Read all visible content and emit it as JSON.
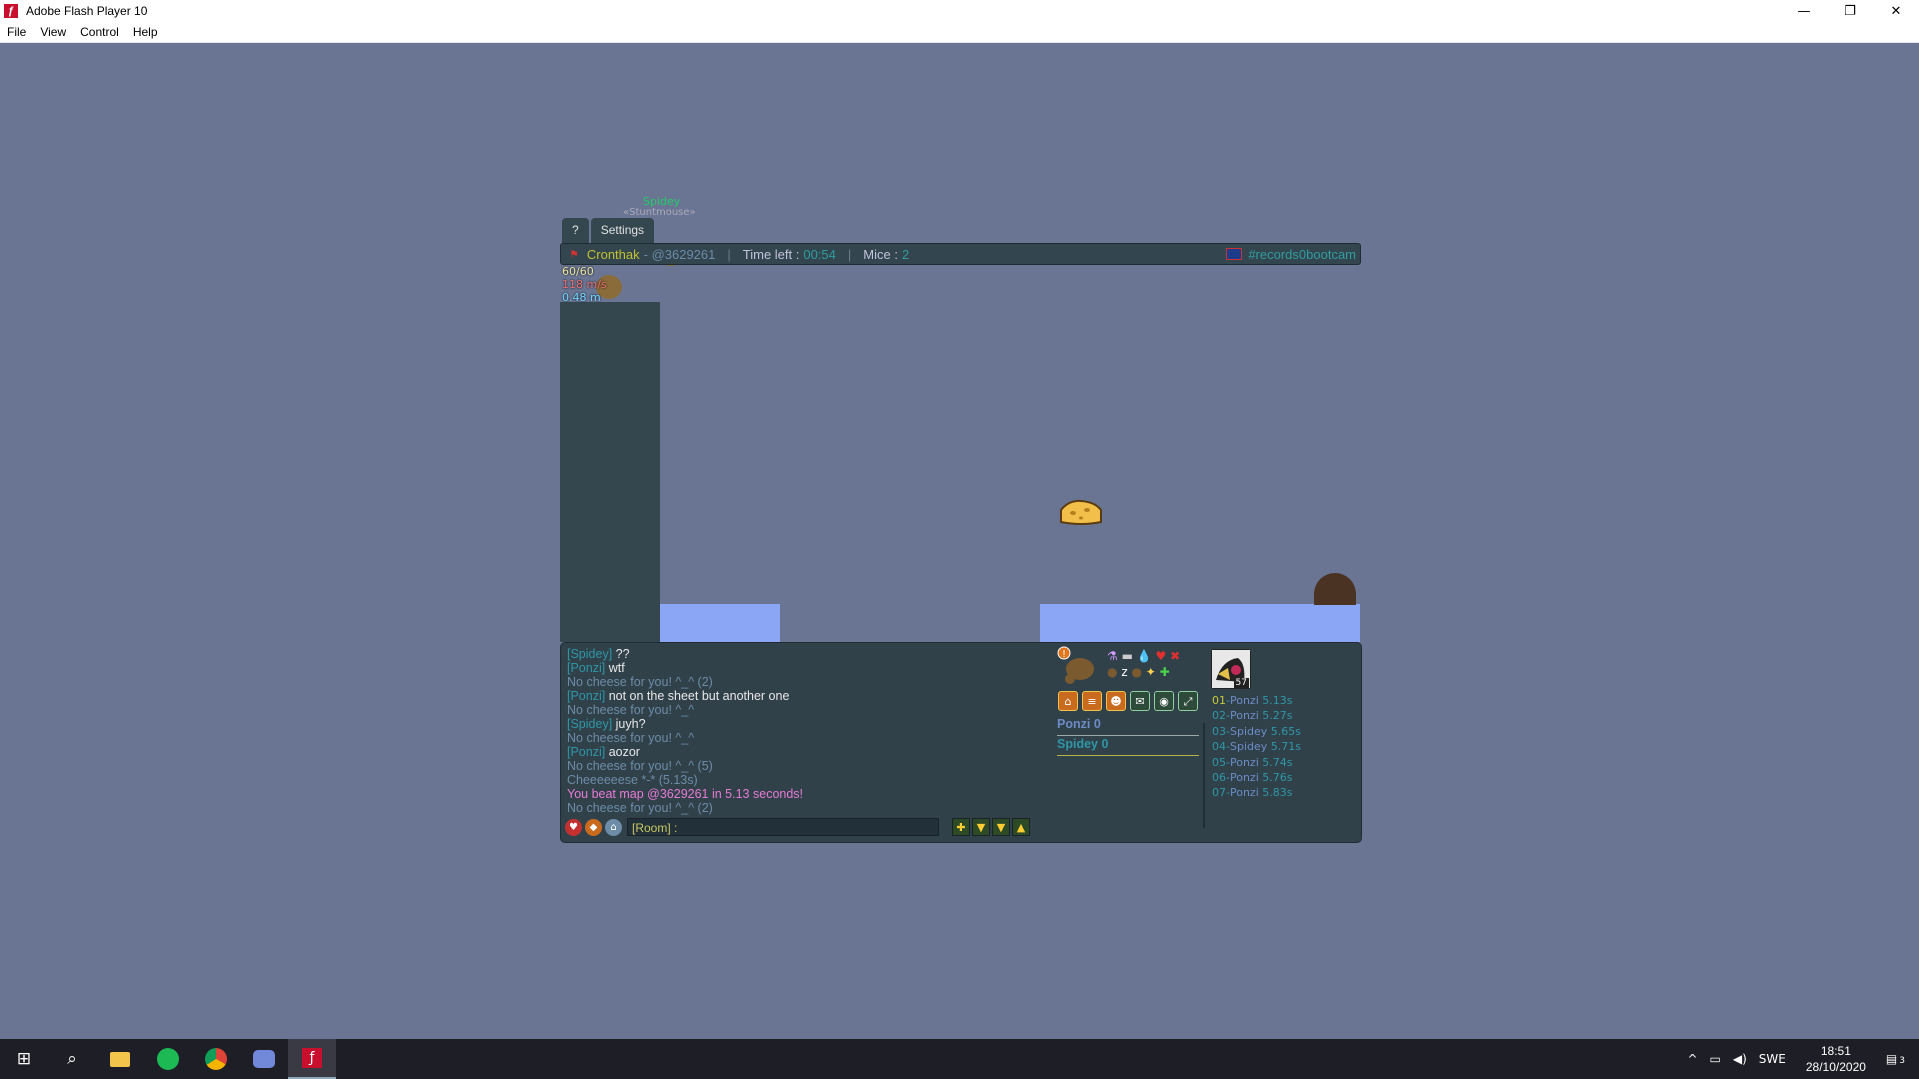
{
  "window": {
    "title": "Adobe Flash Player 10",
    "app_icon": "flash-icon",
    "controls": [
      "minimize",
      "restore",
      "close"
    ]
  },
  "menu": [
    "File",
    "View",
    "Control",
    "Help"
  ],
  "game": {
    "tabs": [
      "?",
      "Settings"
    ],
    "player_overhead": {
      "name": "Spidey",
      "title": "«Stuntmouse»"
    },
    "topbar": {
      "author": "Cronthak",
      "map_code": "- @3629261",
      "time_label": "Time left :",
      "time_value": "00:54",
      "mice_label": "Mice :",
      "mice_value": "2",
      "room": "#records0bootcam"
    },
    "stats": {
      "health": "60/60",
      "speed": "118 m/s",
      "distance": "0.48 m"
    }
  },
  "chat": {
    "lines": [
      {
        "name": "[Spidey]",
        "msg": "??"
      },
      {
        "name": "[Ponzi]",
        "msg": "wtf"
      },
      {
        "sys": "No cheese for you! ^_^ (2)"
      },
      {
        "name": "[Ponzi]",
        "msg": "not on the sheet but another one"
      },
      {
        "sys": "No cheese for you! ^_^"
      },
      {
        "name": "[Spidey]",
        "msg": "juyh?"
      },
      {
        "sys": "No cheese for you! ^_^"
      },
      {
        "name": "[Ponzi]",
        "msg": "aozor"
      },
      {
        "sys": "No cheese for you! ^_^ (5)"
      },
      {
        "sys": "Cheeeeeese *-* (5.13s)"
      },
      {
        "win": "You beat map @3629261 in 5.13 seconds!"
      },
      {
        "sys": "No cheese for you! ^_^ (2)"
      }
    ],
    "input_prefix": "[Room] :",
    "input_value": ""
  },
  "scores": [
    {
      "name": "Ponzi",
      "score": "0"
    },
    {
      "name": "Spidey",
      "score": "0"
    }
  ],
  "level_badge": "57",
  "leaderboard": [
    {
      "rank": "01",
      "name": "Ponzi",
      "time": "5.13s"
    },
    {
      "rank": "02",
      "name": "Ponzi",
      "time": "5.27s"
    },
    {
      "rank": "03",
      "name": "Spidey",
      "time": "5.65s"
    },
    {
      "rank": "04",
      "name": "Spidey",
      "time": "5.71s"
    },
    {
      "rank": "05",
      "name": "Ponzi",
      "time": "5.74s"
    },
    {
      "rank": "06",
      "name": "Ponzi",
      "time": "5.76s"
    },
    {
      "rank": "07",
      "name": "Ponzi",
      "time": "5.83s"
    }
  ],
  "taskbar": {
    "apps": [
      "windows-start-icon",
      "search-icon",
      "file-explorer-icon",
      "spotify-icon",
      "chrome-icon",
      "discord-icon",
      "flash-player-icon"
    ],
    "language": "SWE",
    "time": "18:51",
    "date": "28/10/2020",
    "notifications": "3"
  },
  "colors": {
    "stage_bg": "#6a7594",
    "platform": "#8aa6f4",
    "wall": "#34474f",
    "panel": "#31414a"
  }
}
